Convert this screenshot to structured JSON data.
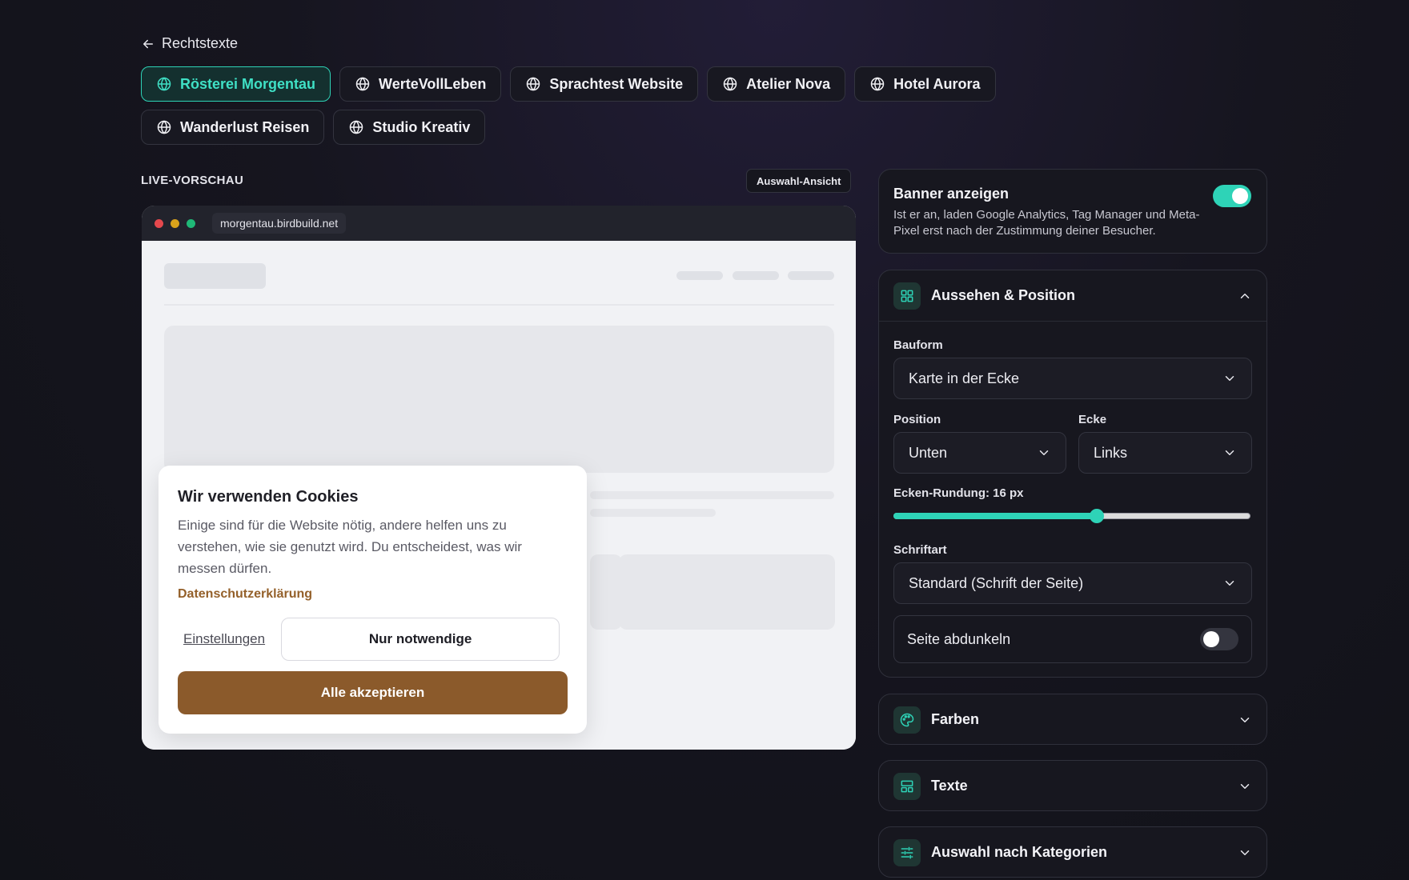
{
  "back": {
    "label": "Rechtstexte"
  },
  "sites": [
    {
      "label": "Rösterei Morgentau",
      "active": true
    },
    {
      "label": "WerteVollLeben",
      "active": false
    },
    {
      "label": "Sprachtest Website",
      "active": false
    },
    {
      "label": "Atelier Nova",
      "active": false
    },
    {
      "label": "Hotel Aurora",
      "active": false
    },
    {
      "label": "Wanderlust Reisen",
      "active": false
    },
    {
      "label": "Studio Kreativ",
      "active": false
    }
  ],
  "preview": {
    "label": "LIVE-VORSCHAU",
    "view_button": "Auswahl-Ansicht",
    "url": "morgentau.birdbuild.net",
    "cookie": {
      "title": "Wir verwenden Cookies",
      "text": "Einige sind für die Website nötig, andere helfen uns zu verstehen, wie sie genutzt wird. Du entscheidest, was wir messen dürfen.",
      "privacy_link": "Datenschutzerklärung",
      "settings": "Einstellungen",
      "necessary": "Nur notwendige",
      "accept": "Alle akzeptieren"
    }
  },
  "banner": {
    "title": "Banner anzeigen",
    "description": "Ist er an, laden Google Analytics, Tag Manager und Meta-Pixel erst nach der Zustimmung deiner Besucher.",
    "enabled": true
  },
  "appearance": {
    "title": "Aussehen & Position",
    "shape_label": "Bauform",
    "shape_value": "Karte in der Ecke",
    "position_label": "Position",
    "position_value": "Unten",
    "corner_label": "Ecke",
    "corner_value": "Links",
    "radius_label": "Ecken-Rundung: 16 px",
    "radius_fraction": 0.57,
    "font_label": "Schriftart",
    "font_value": "Standard (Schrift der Seite)",
    "darken_label": "Seite abdunkeln",
    "darken_enabled": false
  },
  "sections": {
    "colors": "Farben",
    "texts": "Texte",
    "categories": "Auswahl nach Kategorien"
  },
  "colors": {
    "accent": "#2ed3b7",
    "brand_brown": "#8b5a2b",
    "link_brown": "#94602a",
    "dot_red": "#e5484d",
    "dot_yellow": "#d9a21b",
    "dot_green": "#1fb877"
  },
  "icons": [
    "arrow-left-icon",
    "globe-icon",
    "grid-icon",
    "palette-icon",
    "layout-icon",
    "sliders-icon",
    "chevron-up-icon",
    "chevron-down-icon"
  ]
}
